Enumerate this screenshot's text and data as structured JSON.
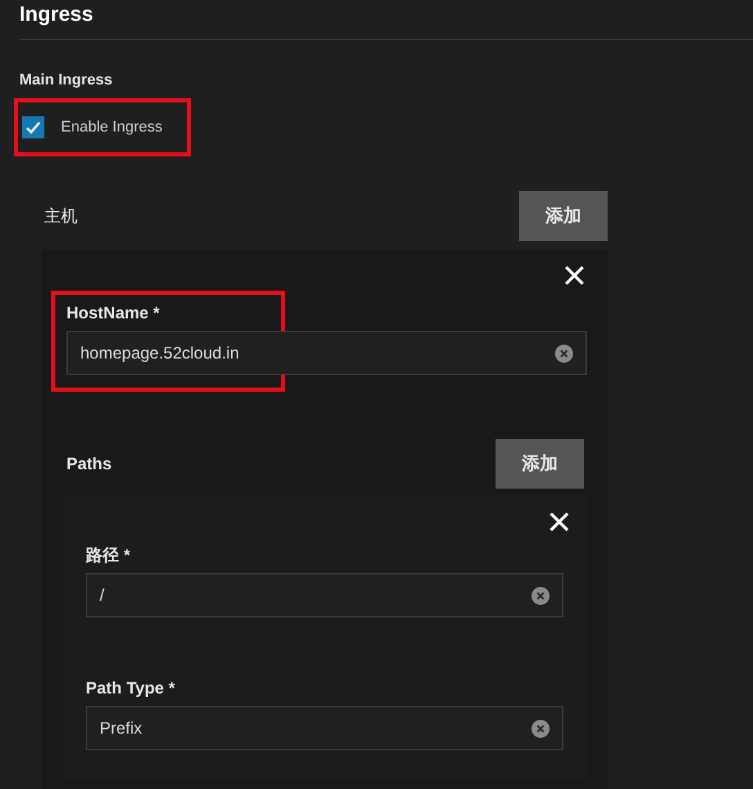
{
  "section": {
    "title": "Ingress"
  },
  "main_ingress": {
    "heading": "Main Ingress",
    "enable": {
      "label": "Enable Ingress",
      "checked": true,
      "highlighted": true
    }
  },
  "hosts": {
    "label": "主机",
    "add_button": "添加",
    "items": [
      {
        "hostname": {
          "label": "HostName *",
          "value": "homepage.52cloud.in",
          "highlighted": true
        },
        "paths": {
          "label": "Paths",
          "add_button": "添加",
          "items": [
            {
              "fields": [
                {
                  "label": "路径 *",
                  "value": "/"
                },
                {
                  "label": "Path Type *",
                  "value": "Prefix"
                }
              ]
            }
          ]
        }
      }
    ]
  }
}
